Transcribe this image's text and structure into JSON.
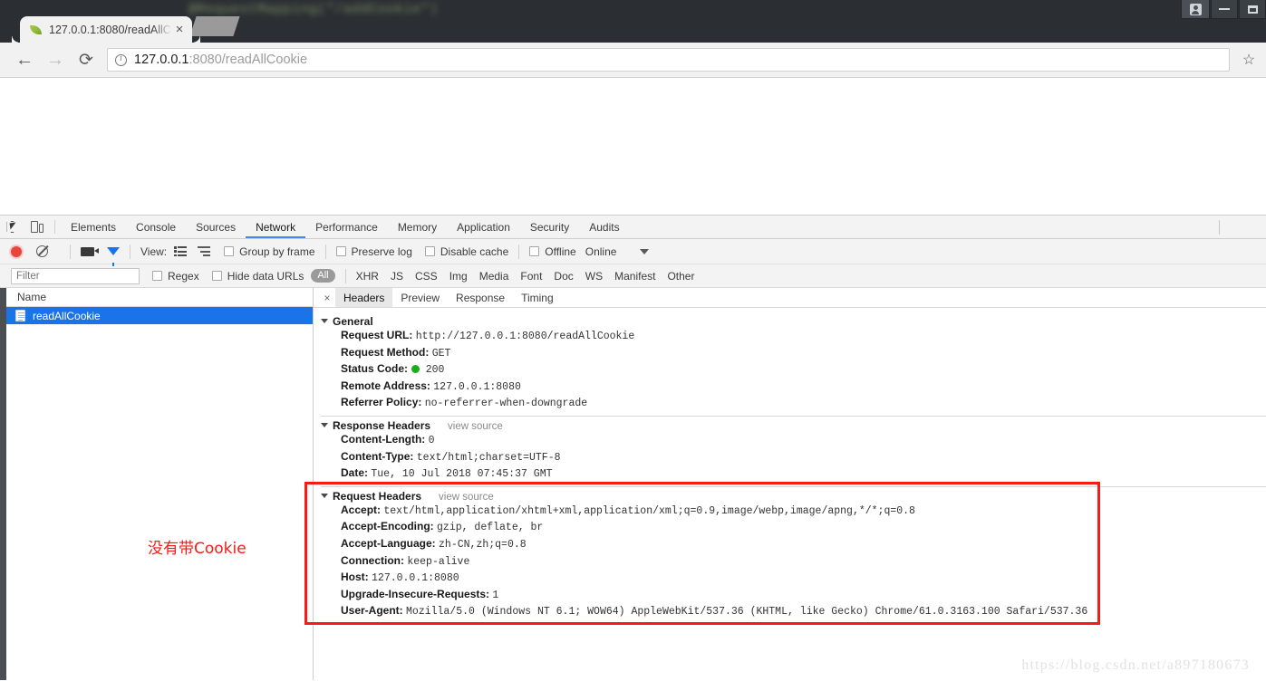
{
  "window": {
    "controls": [
      {
        "name": "user-profile-button",
        "icon": "user-icon"
      },
      {
        "name": "minimize-button",
        "icon": "minimize-icon"
      },
      {
        "name": "maximize-button",
        "icon": "maximize-icon"
      }
    ],
    "background_blurred_text": "@RequestMapping(\"/addCookie\")"
  },
  "tab": {
    "title": "127.0.0.1:8080/readAllC",
    "close_label": "×",
    "favicon": "leaf-icon"
  },
  "toolbar": {
    "back_glyph": "←",
    "forward_glyph": "→",
    "reload_glyph": "⟳",
    "star_glyph": "☆",
    "url_host": "127.0.0.1",
    "url_rest": ":8080/readAllCookie",
    "url_full": "127.0.0.1:8080/readAllCookie"
  },
  "devtools": {
    "panels": [
      "Elements",
      "Console",
      "Sources",
      "Network",
      "Performance",
      "Memory",
      "Application",
      "Security",
      "Audits"
    ],
    "active_panel": "Network",
    "network_toolbar": {
      "view_label": "View:",
      "group_by_frame": "Group by frame",
      "preserve_log": "Preserve log",
      "disable_cache": "Disable cache",
      "offline": "Offline",
      "online": "Online"
    },
    "filter_bar": {
      "placeholder": "Filter",
      "value": "",
      "regex": "Regex",
      "hide_data_urls": "Hide data URLs",
      "all_badge": "All",
      "types": [
        "XHR",
        "JS",
        "CSS",
        "Img",
        "Media",
        "Font",
        "Doc",
        "WS",
        "Manifest",
        "Other"
      ]
    },
    "request_list": {
      "column_header": "Name",
      "rows": [
        {
          "name": "readAllCookie",
          "selected": true
        }
      ]
    },
    "detail_tabs": {
      "close_glyph": "×",
      "tabs": [
        "Headers",
        "Preview",
        "Response",
        "Timing"
      ],
      "active": "Headers"
    },
    "headers": {
      "general": {
        "title": "General",
        "items": [
          {
            "key": "Request URL:",
            "value": "http://127.0.0.1:8080/readAllCookie"
          },
          {
            "key": "Request Method:",
            "value": "GET"
          },
          {
            "key": "Status Code:",
            "value": "200",
            "status_dot": "#1aad19"
          },
          {
            "key": "Remote Address:",
            "value": "127.0.0.1:8080"
          },
          {
            "key": "Referrer Policy:",
            "value": "no-referrer-when-downgrade"
          }
        ]
      },
      "response": {
        "title": "Response Headers",
        "view_source": "view source",
        "items": [
          {
            "key": "Content-Length:",
            "value": "0"
          },
          {
            "key": "Content-Type:",
            "value": "text/html;charset=UTF-8"
          },
          {
            "key": "Date:",
            "value": "Tue, 10 Jul 2018 07:45:37 GMT"
          }
        ]
      },
      "request": {
        "title": "Request Headers",
        "view_source": "view source",
        "items": [
          {
            "key": "Accept:",
            "value": "text/html,application/xhtml+xml,application/xml;q=0.9,image/webp,image/apng,*/*;q=0.8"
          },
          {
            "key": "Accept-Encoding:",
            "value": "gzip, deflate, br"
          },
          {
            "key": "Accept-Language:",
            "value": "zh-CN,zh;q=0.8"
          },
          {
            "key": "Connection:",
            "value": "keep-alive"
          },
          {
            "key": "Host:",
            "value": "127.0.0.1:8080"
          },
          {
            "key": "Upgrade-Insecure-Requests:",
            "value": "1"
          },
          {
            "key": "User-Agent:",
            "value": "Mozilla/5.0 (Windows NT 6.1; WOW64) AppleWebKit/537.36 (KHTML, like Gecko) Chrome/61.0.3163.100 Safari/537.36"
          }
        ]
      }
    }
  },
  "annotation": {
    "text": "没有带Cookie",
    "color": "#fb1a13"
  },
  "watermark": {
    "text": "https://blog.csdn.net/a897180673"
  }
}
